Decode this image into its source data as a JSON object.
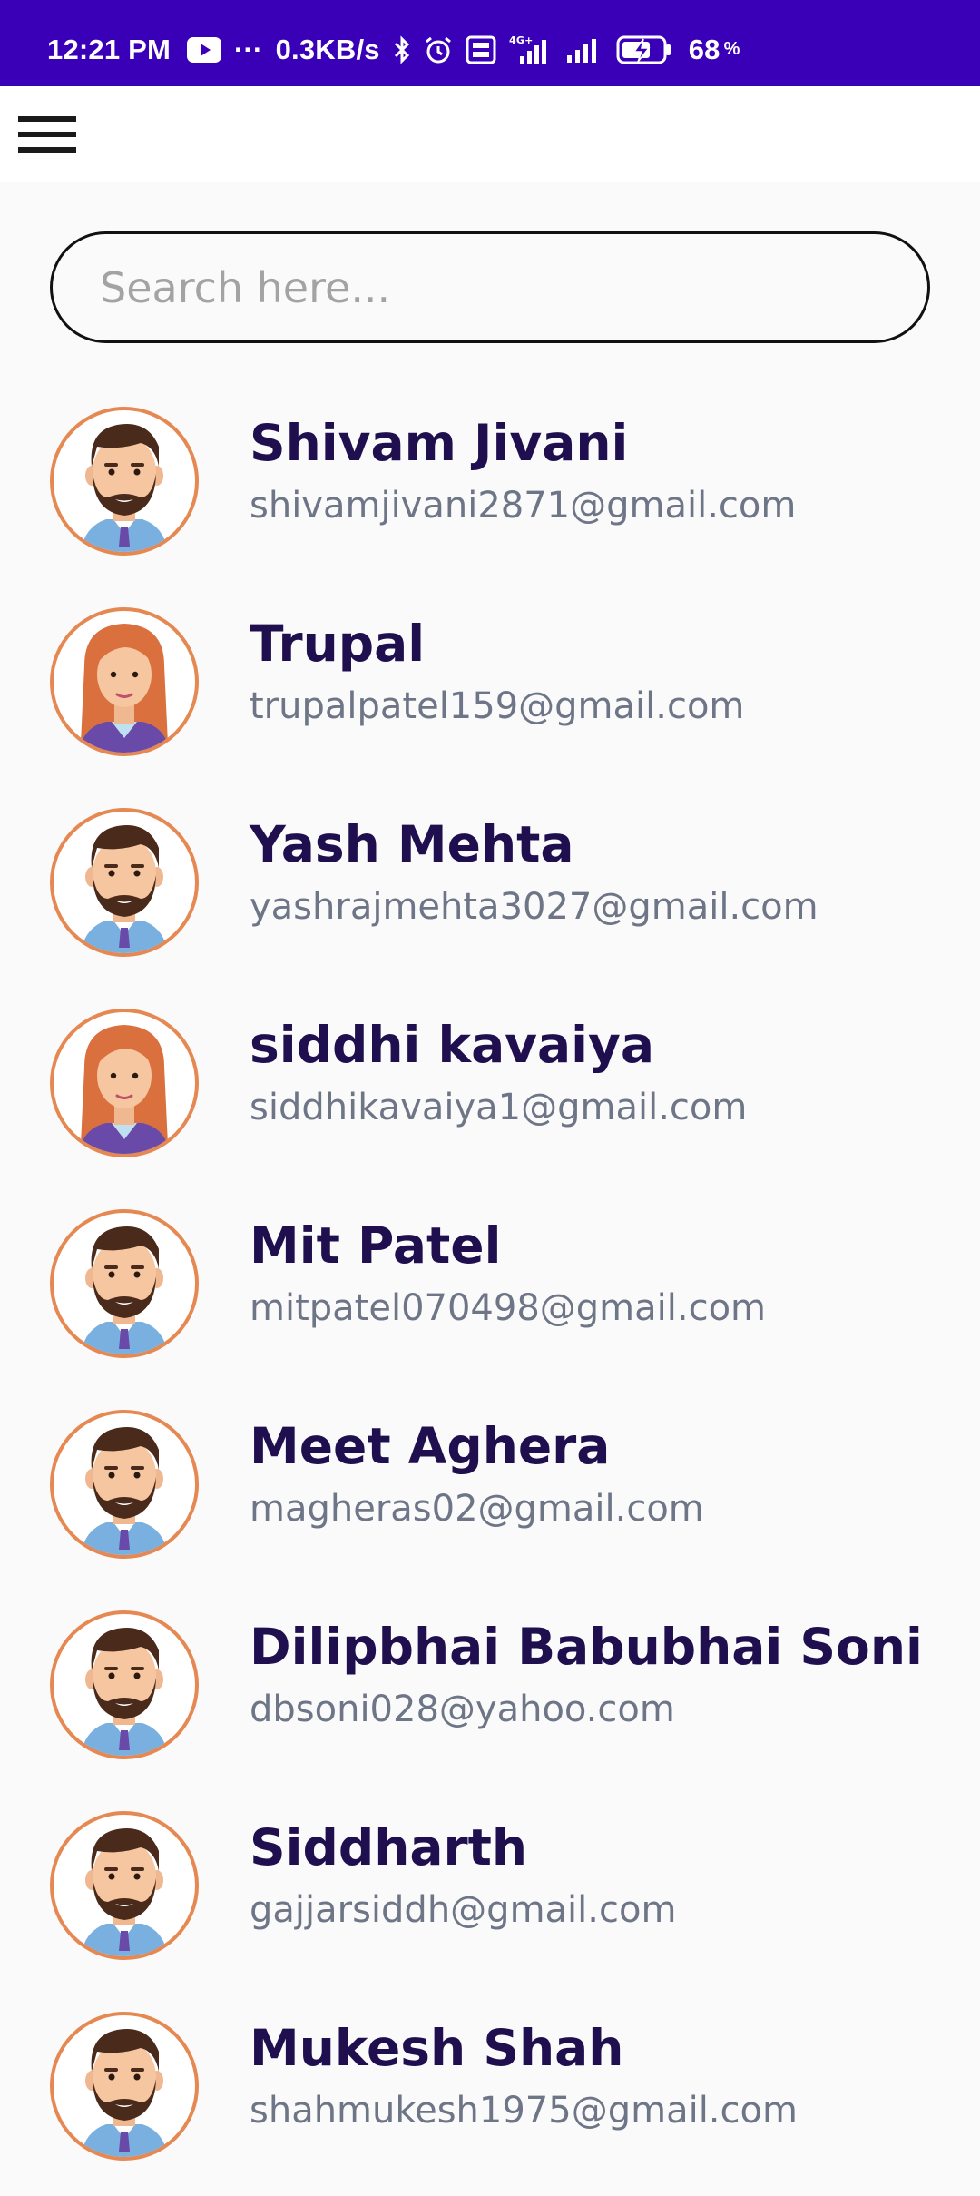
{
  "status_bar": {
    "time": "12:21 PM",
    "dots": "···",
    "speed": "0.3KB/s",
    "network_type": "4G+",
    "battery": "68",
    "battery_unit": "%",
    "background": "#3a00b8"
  },
  "app_bar": {
    "menu_icon": "hamburger-menu-icon"
  },
  "search": {
    "placeholder": "Search here..."
  },
  "users": [
    {
      "name": "Shivam Jivani",
      "email": "shivamjivani2871@gmail.com",
      "avatar": "male-avatar"
    },
    {
      "name": "Trupal",
      "email": "trupalpatel159@gmail.com",
      "avatar": "female-avatar"
    },
    {
      "name": "Yash Mehta",
      "email": "yashrajmehta3027@gmail.com",
      "avatar": "male-avatar"
    },
    {
      "name": "siddhi kavaiya",
      "email": "siddhikavaiya1@gmail.com",
      "avatar": "female-avatar"
    },
    {
      "name": "Mit Patel",
      "email": "mitpatel070498@gmail.com",
      "avatar": "male-avatar"
    },
    {
      "name": "Meet Aghera",
      "email": "magheras02@gmail.com",
      "avatar": "male-avatar"
    },
    {
      "name": "Dilipbhai Babubhai Soni",
      "email": "dbsoni028@yahoo.com",
      "avatar": "male-avatar"
    },
    {
      "name": "Siddharth",
      "email": "gajjarsiddh@gmail.com",
      "avatar": "male-avatar"
    },
    {
      "name": "Mukesh Shah",
      "email": "shahmukesh1975@gmail.com",
      "avatar": "male-avatar"
    }
  ],
  "colors": {
    "accent": "#3a00b8",
    "name_text": "#1f0f4e",
    "email_text": "#6d7587",
    "avatar_border": "#e58852"
  }
}
